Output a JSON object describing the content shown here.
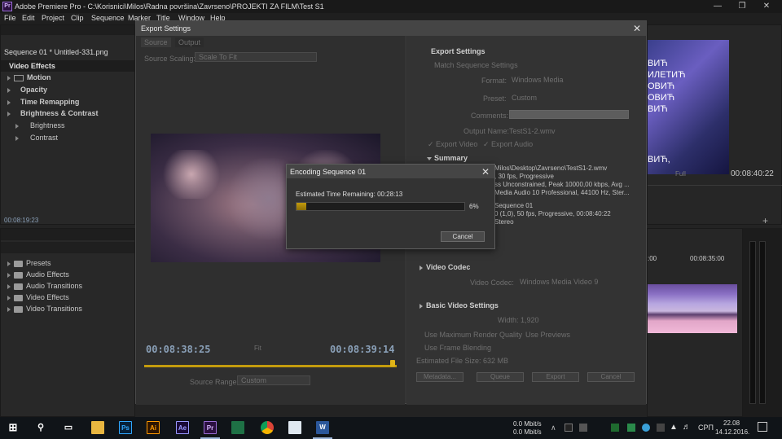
{
  "window": {
    "title": "Adobe Premiere Pro - C:\\Korisnici\\Milos\\Radna površina\\Zavrseno\\PROJEKTI ZA FILM\\Test S1",
    "logo": "Pr"
  },
  "menu": [
    "File",
    "Edit",
    "Project",
    "Clip",
    "Sequence",
    "Marker",
    "Title",
    "Window",
    "Help"
  ],
  "effect_controls": {
    "tab": "Sequence 01 * Untitled-331.png",
    "section": "Video Effects",
    "items": [
      "Motion",
      "Opacity",
      "Time Remapping",
      "Brightness & Contrast",
      "Brightness",
      "Contrast"
    ],
    "timecode": "00:08:19:23"
  },
  "effects_panel": {
    "folders": [
      "Presets",
      "Audio Effects",
      "Audio Transitions",
      "Video Effects",
      "Video Transitions"
    ]
  },
  "export_dialog": {
    "title": "Export Settings",
    "tabs": [
      "Source",
      "Output"
    ],
    "source_scaling_label": "Source Scaling:",
    "source_scaling_value": "Scale To Fit",
    "timecode_in": "00:08:38:25",
    "timecode_out": "00:08:39:14",
    "fit_label": "Fit",
    "source_range_label": "Source Range:",
    "source_range_value": "Custom",
    "settings_heading": "Export Settings",
    "match_sequence": "Match Sequence Settings",
    "format_label": "Format:",
    "format_value": "Windows Media",
    "preset_label": "Preset:",
    "preset_value": "Custom",
    "comments_label": "Comments:",
    "output_name_label": "Output Name:",
    "output_name_value": "TestS1-2.wmv",
    "export_video": "Export Video",
    "export_audio": "Export Audio",
    "summary_heading": "Summary",
    "summary_lines": [
      "Milos\\Desktop\\Zavrseno\\TestS1-2.wmv",
      ", 30 fps, Progressive",
      "ss Unconstrained, Peak 10000,00 kbps, Avg ...",
      "Media Audio 10 Professional, 44100 Hz, Ster...",
      "Sequence 01",
      "0 (1,0), 50 fps, Progressive, 00:08:40:22",
      "Stereo"
    ],
    "video_codec_heading": "Video Codec",
    "video_codec_label": "Video Codec:",
    "video_codec_value": "Windows Media Video 9",
    "basic_video_heading": "Basic Video Settings",
    "width_label": "Width:",
    "width_value": "1,920",
    "use_max_render": "Use Maximum Render Quality",
    "use_previews": "Use Previews",
    "use_frame_blending": "Use Frame Blending",
    "file_size": "Estimated File Size: 632 MB",
    "buttons": [
      "Metadata...",
      "Queue",
      "Export",
      "Cancel"
    ]
  },
  "encoding": {
    "title": "Encoding Sequence 01",
    "remaining_label": "Estimated Time Remaining:",
    "remaining_value": "00:28:13",
    "progress": 6,
    "progress_label": "6%",
    "cancel": "Cancel"
  },
  "right_panel": {
    "subtitle_lines": [
      "ВИЋ",
      "ИЛЕТИЋ",
      "ОВИЋ",
      "ОВИЋ",
      "ВИЋ",
      "ВИЋ,"
    ],
    "fit_label": "Full",
    "timecode": "00:08:40:22",
    "timeline_timecodes": [
      ":00",
      "00:08:35:00"
    ]
  },
  "taskbar": {
    "icons": [
      "windows-start-icon",
      "search-icon",
      "task-view-icon",
      "file-explorer-icon",
      "photoshop-icon",
      "illustrator-icon",
      "after-effects-icon",
      "premiere-icon",
      "excel-icon",
      "chrome-icon",
      "notepad-icon",
      "word-icon"
    ],
    "icon_labels": [
      "",
      "",
      "",
      "",
      "Ps",
      "Ai",
      "Ae",
      "Pr",
      "",
      "",
      "",
      "W"
    ],
    "network_up": "0.0 Mbit/s",
    "network_down": "0.0 Mbit/s",
    "language": "СРП",
    "time": "22.08",
    "date": "14.12.2016."
  },
  "colors": {
    "accent_yellow": "#c39b0d",
    "premiere_purple": "#9a6dd6",
    "timecode_blue": "#8aa0b8"
  }
}
